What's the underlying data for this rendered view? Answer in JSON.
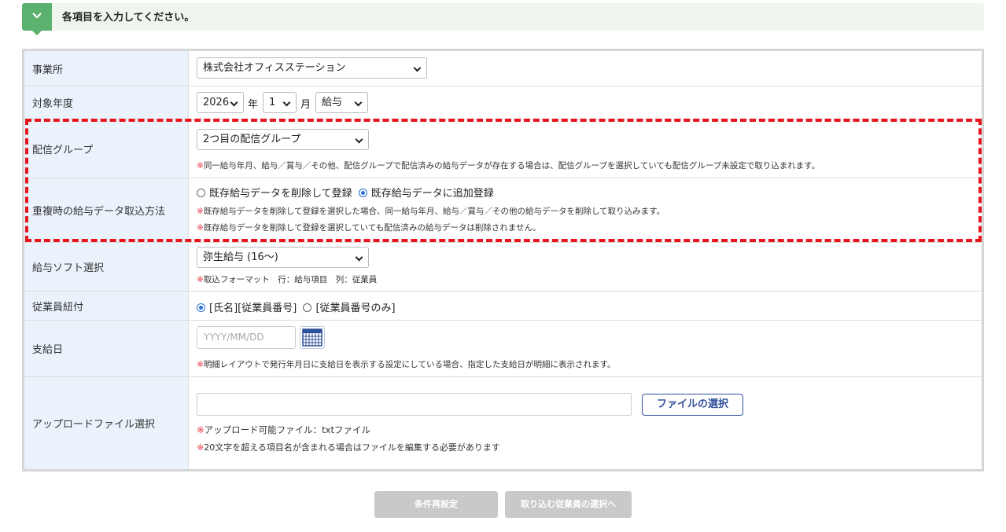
{
  "banner": {
    "text": "各項目を入力してください。"
  },
  "rows": {
    "office": {
      "label": "事業所",
      "value": "株式会社オフィスステーション"
    },
    "year": {
      "label": "対象年度",
      "year_value": "2026",
      "year_unit": "年",
      "month_value": "1",
      "month_unit": "月",
      "type_value": "給与"
    },
    "group": {
      "label": "配信グループ",
      "value": "2つ目の配信グループ",
      "note_mark": "※",
      "note": "同一給与年月、給与／賞与／その他、配信グループで配信済みの給与データが存在する場合は、配信グループを選択していても配信グループ未設定で取り込まれます。"
    },
    "duplicate": {
      "label": "重複時の給与データ取込方法",
      "option1": "既存給与データを削除して登録",
      "option2": "既存給与データに追加登録",
      "selected": "option2",
      "note1_mark": "※",
      "note1": "既存給与データを削除して登録を選択した場合、同一給与年月、給与／賞与／その他の給与データを削除して取り込みます。",
      "note2_mark": "※",
      "note2": "既存給与データを削除して登録を選択していても配信済みの給与データは削除されません。"
    },
    "software": {
      "label": "給与ソフト選択",
      "value": "弥生給与 (16～)",
      "note_mark": "※",
      "note": "取込フォーマット　行：給与項目　列：従業員"
    },
    "employee": {
      "label": "従業員紐付",
      "option1": "[氏名][従業員番号]",
      "option2": "[従業員番号のみ]",
      "selected": "option1"
    },
    "payday": {
      "label": "支給日",
      "placeholder": "YYYY/MM/DD",
      "note_mark": "※",
      "note": "明細レイアウトで発行年月日に支給日を表示する設定にしている場合、指定した支給日が明細に表示されます。"
    },
    "upload": {
      "label": "アップロードファイル選択",
      "button": "ファイルの選択",
      "note1_mark": "※",
      "note1": "アップロード可能ファイル：txtファイル",
      "note2_mark": "※",
      "note2": "20文字を超える項目名が含まれる場合はファイルを編集する必要があります"
    }
  },
  "buttons": {
    "reset": "条件再設定",
    "next": "取り込む従業員の選択へ"
  },
  "colors": {
    "accent_green": "#5bb16e",
    "label_bg": "#eaf3fb",
    "highlight_red": "#e8141c",
    "disabled_button": "#c9c9c9",
    "note_mark": "#e4303c"
  },
  "icons": {
    "banner": "chevron-down-icon",
    "calendar": "calendar-icon"
  }
}
